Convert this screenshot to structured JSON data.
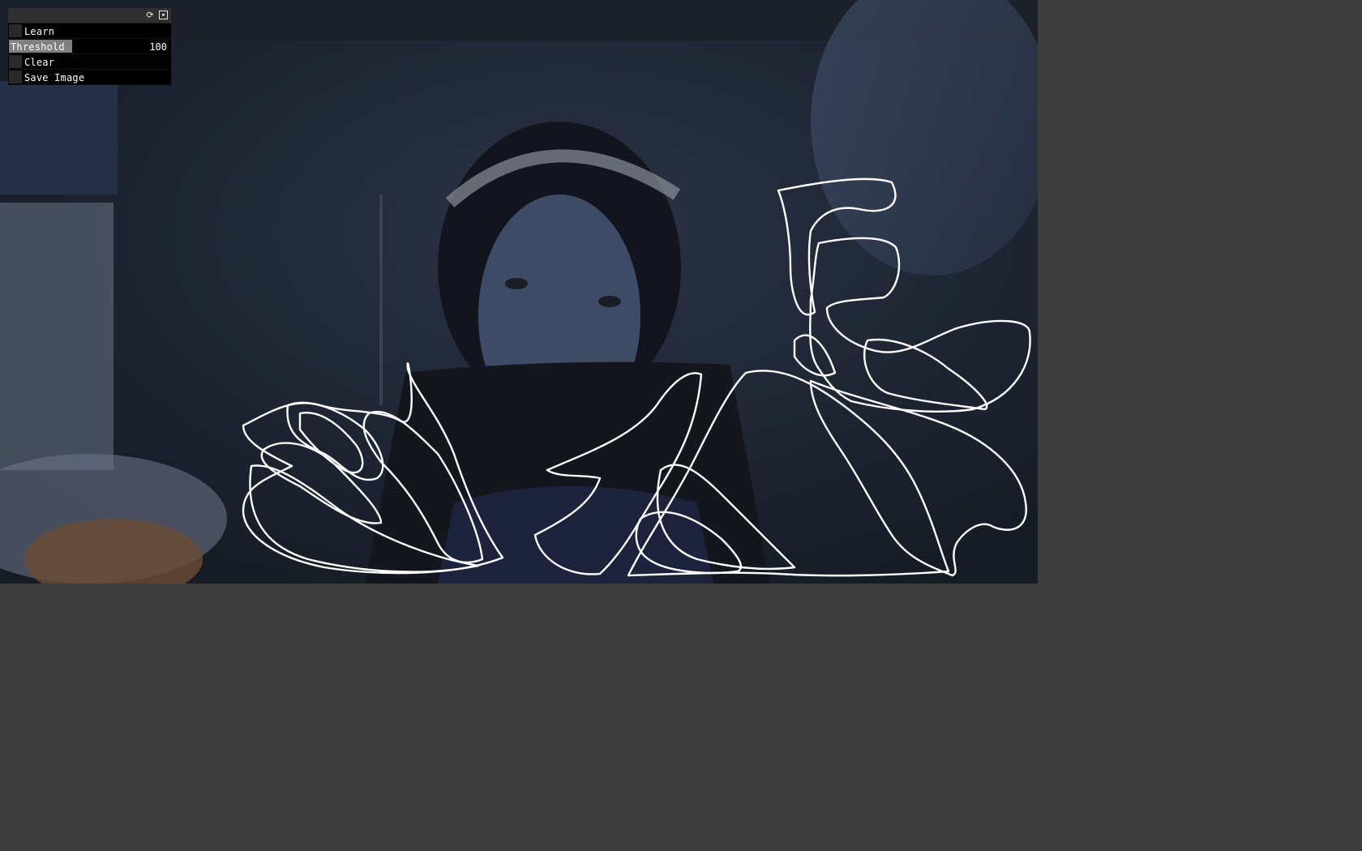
{
  "gui": {
    "header_title": "",
    "icons": {
      "reload": "reload-icon",
      "save": "save-icon"
    },
    "learn": {
      "label": "Learn",
      "checked": false
    },
    "threshold": {
      "label": "Threshold",
      "value": "100",
      "fraction": 0.39
    },
    "clear": {
      "label": "Clear",
      "checked": false
    },
    "save_image": {
      "label": "Save Image",
      "checked": false
    }
  },
  "colors": {
    "background": "#3d3d3d",
    "panel": "#000000",
    "slider_fill": "#808080",
    "contour": "#ffffff"
  }
}
